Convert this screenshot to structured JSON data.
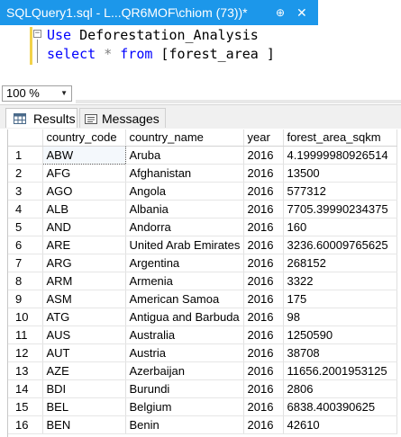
{
  "tab": {
    "title": "SQLQuery1.sql - L...QR6MOF\\chiom (73))*",
    "pin_icon": "pin-icon",
    "close_icon": "close-icon",
    "pin_glyph": "⊕",
    "close_glyph": "✕"
  },
  "editor": {
    "line1_kw": "Use",
    "line1_text": " Deforestation_Analysis",
    "line2_kw1": "select",
    "line2_star": " * ",
    "line2_kw2": "from",
    "line2_text": " [forest_area ]",
    "collapse_glyph": "−"
  },
  "zoom": {
    "value": "100 %",
    "arrow": "▼"
  },
  "results_tabs": {
    "results": "Results",
    "messages": "Messages"
  },
  "grid": {
    "columns": [
      "",
      "country_code",
      "country_name",
      "year",
      "forest_area_sqkm"
    ],
    "rows": [
      [
        "1",
        "ABW",
        "Aruba",
        "2016",
        "4.19999980926514"
      ],
      [
        "2",
        "AFG",
        "Afghanistan",
        "2016",
        "13500"
      ],
      [
        "3",
        "AGO",
        "Angola",
        "2016",
        "577312"
      ],
      [
        "4",
        "ALB",
        "Albania",
        "2016",
        "7705.39990234375"
      ],
      [
        "5",
        "AND",
        "Andorra",
        "2016",
        "160"
      ],
      [
        "6",
        "ARE",
        "United Arab Emirates",
        "2016",
        "3236.60009765625"
      ],
      [
        "7",
        "ARG",
        "Argentina",
        "2016",
        "268152"
      ],
      [
        "8",
        "ARM",
        "Armenia",
        "2016",
        "3322"
      ],
      [
        "9",
        "ASM",
        "American Samoa",
        "2016",
        "175"
      ],
      [
        "10",
        "ATG",
        "Antigua and Barbuda",
        "2016",
        "98"
      ],
      [
        "11",
        "AUS",
        "Australia",
        "2016",
        "1250590"
      ],
      [
        "12",
        "AUT",
        "Austria",
        "2016",
        "38708"
      ],
      [
        "13",
        "AZE",
        "Azerbaijan",
        "2016",
        "11656.2001953125"
      ],
      [
        "14",
        "BDI",
        "Burundi",
        "2016",
        "2806"
      ],
      [
        "15",
        "BEL",
        "Belgium",
        "2016",
        "6838.400390625"
      ],
      [
        "16",
        "BEN",
        "Benin",
        "2016",
        "42610"
      ]
    ]
  },
  "colors": {
    "tab_accent": "#1c97ea",
    "keyword": "#0000ff",
    "operator": "#808080",
    "modified_bar": "#f2d24a"
  }
}
